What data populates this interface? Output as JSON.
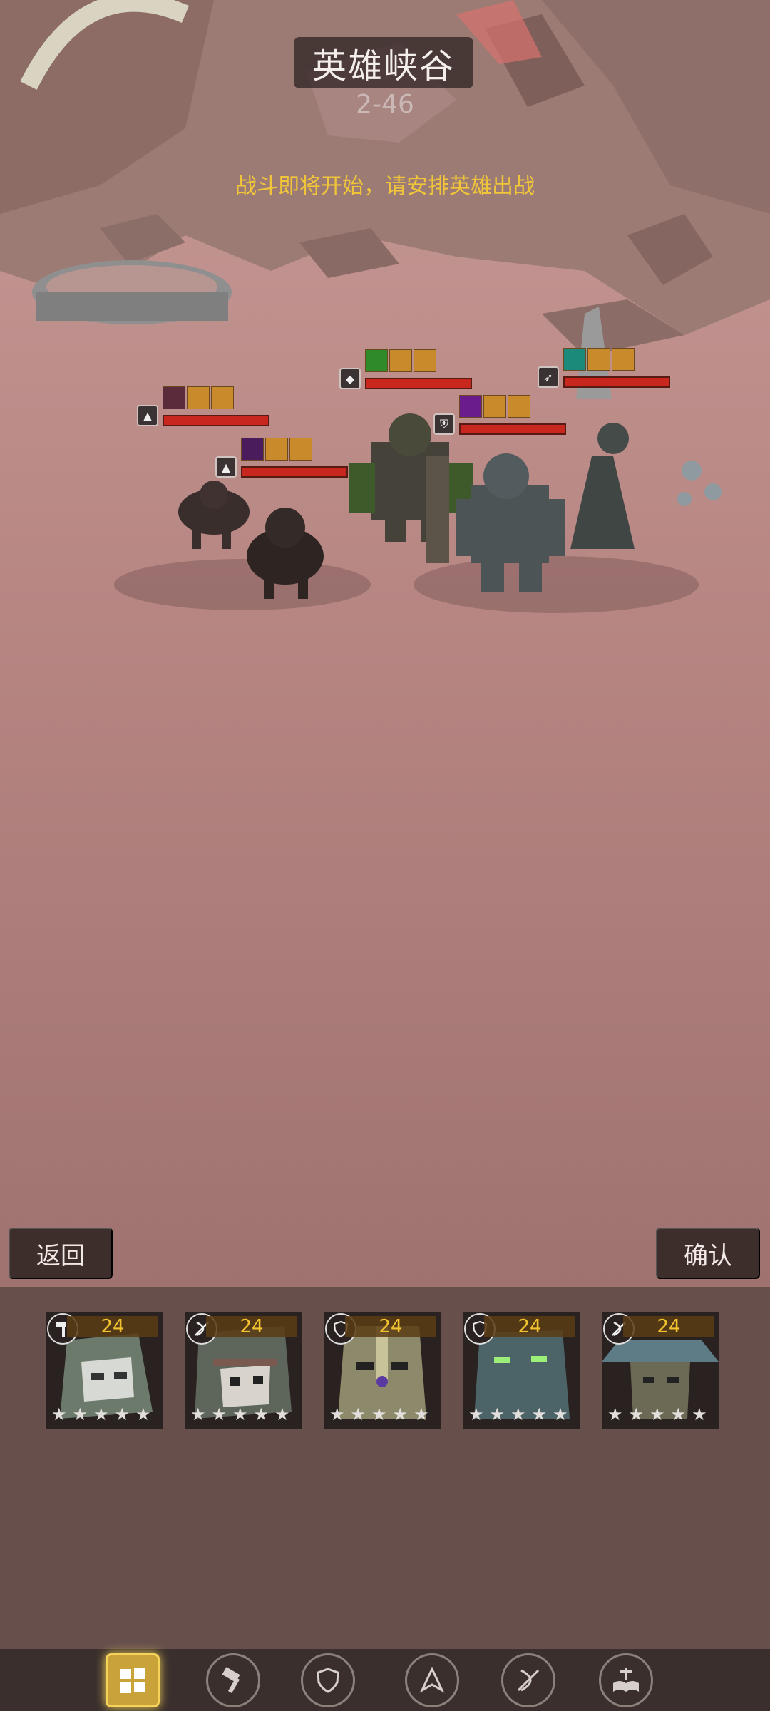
{
  "stage": {
    "title": "英雄峡谷",
    "level": "2-46",
    "hint": "战斗即将开始，请安排英雄出战"
  },
  "buttons": {
    "back": "返回",
    "confirm": "确认"
  },
  "enemies": [
    {
      "class_icon": "assassin-icon",
      "hp": 1.0
    },
    {
      "class_icon": "assassin-icon",
      "hp": 1.0
    },
    {
      "class_icon": "support-icon",
      "hp": 1.0
    },
    {
      "class_icon": "tank-icon",
      "hp": 1.0
    },
    {
      "class_icon": "archer-icon",
      "hp": 1.0
    }
  ],
  "heroes": [
    {
      "class_icon": "warrior-hammer-icon",
      "level": "24",
      "stars": 5
    },
    {
      "class_icon": "archer-icon",
      "level": "24",
      "stars": 5
    },
    {
      "class_icon": "tank-shield-icon",
      "level": "24",
      "stars": 5
    },
    {
      "class_icon": "tank-shield-icon",
      "level": "24",
      "stars": 5
    },
    {
      "class_icon": "archer-icon",
      "level": "24",
      "stars": 5
    }
  ],
  "nav": [
    {
      "name": "formation-icon",
      "active": true
    },
    {
      "name": "warrior-hammer-icon",
      "active": false
    },
    {
      "name": "tank-shield-icon",
      "active": false
    },
    {
      "name": "assassin-icon",
      "active": false
    },
    {
      "name": "archer-icon",
      "active": false
    },
    {
      "name": "mage-book-icon",
      "active": false
    }
  ],
  "colors": {
    "hp": "#c7271d",
    "level": "#f2c230",
    "hint": "#f0c53a",
    "nav_active": "#f5d35a"
  }
}
